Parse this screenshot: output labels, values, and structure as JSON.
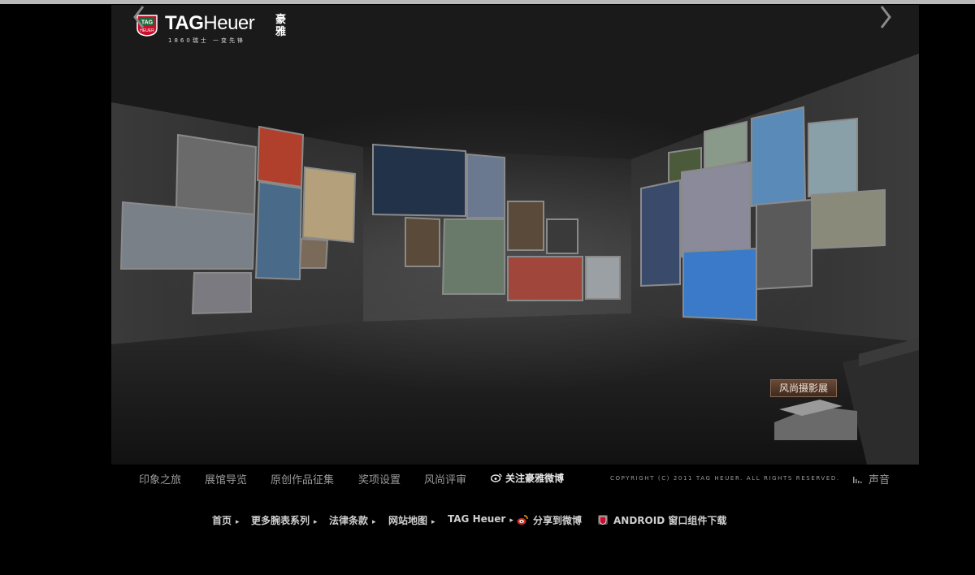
{
  "brand": {
    "logo_text": "TAG",
    "logo_sub": "HEUER",
    "name_bold": "TAG",
    "name_light": "Heuer",
    "name_cn": "豪雅",
    "tagline": "1860瑞士 一变先锋"
  },
  "stage": {
    "exhibit_label": "风尚摄影展",
    "prev_icon": "chevron-left-icon",
    "next_icon": "chevron-right-icon"
  },
  "menu": {
    "items": [
      "印象之旅",
      "展馆导览",
      "原创作品征集",
      "奖项设置",
      "风尚评审"
    ],
    "weibo_follow": "关注豪雅微博",
    "copyright": "COPYRIGHT (C) 2011 TAG HEUER. ALL RIGHTS RESERVED.",
    "sound": "声音"
  },
  "footer": {
    "home": "首页",
    "more_series": "更多腕表系列",
    "legal": "法律条款",
    "sitemap": "网站地图",
    "tag_heuer": "TAG Heuer",
    "share_weibo": "分享到微博",
    "android_widget": "ANDROID 窗口组件下载"
  },
  "colors": {
    "background": "#000000",
    "menu_text": "#9a9a9a",
    "exhibit_label_bg": "#5a3e2c",
    "weibo_red": "#d52b1e",
    "logo_red": "#c8102e"
  }
}
